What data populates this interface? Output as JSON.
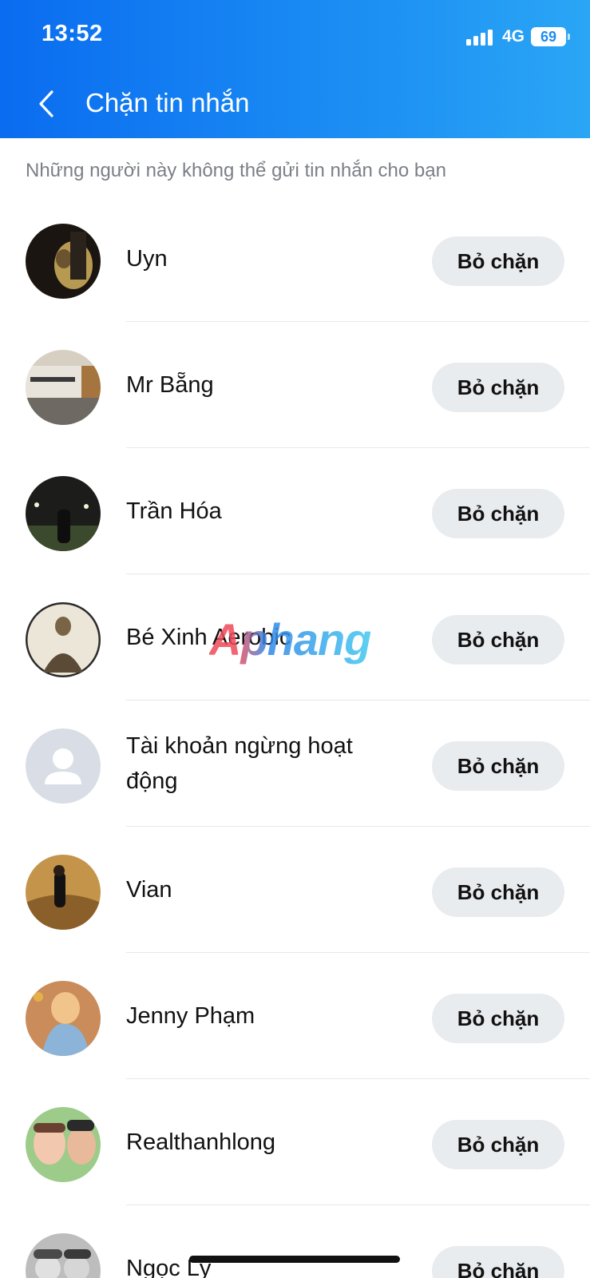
{
  "status_bar": {
    "time": "13:52",
    "network": "4G",
    "battery": "69"
  },
  "header": {
    "title": "Chặn tin nhắn"
  },
  "subtitle": "Những người này không thể gửi tin nhắn cho bạn",
  "unblock_label": "Bỏ chặn",
  "blocked_users": [
    {
      "name": "Uyn",
      "avatar": "photo"
    },
    {
      "name": "Mr Bẵng",
      "avatar": "photo"
    },
    {
      "name": "Trần Hóa",
      "avatar": "photo"
    },
    {
      "name": "Bé Xinh Aerobic",
      "avatar": "photo"
    },
    {
      "name": "Tài khoản ngừng hoạt động",
      "avatar": "default-person-icon"
    },
    {
      "name": "Vian",
      "avatar": "photo"
    },
    {
      "name": "Jenny Phạm",
      "avatar": "photo"
    },
    {
      "name": "Realthanhlong",
      "avatar": "photo"
    },
    {
      "name": "Ngọc Lý",
      "avatar": "photo"
    }
  ],
  "watermark": "Aphang"
}
